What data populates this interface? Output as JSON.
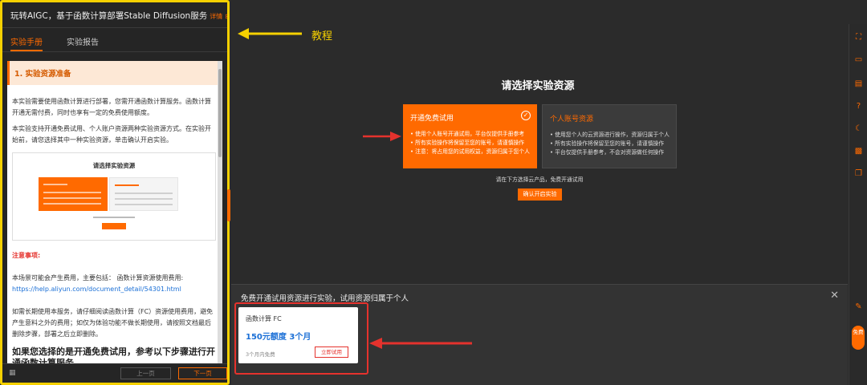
{
  "left_panel": {
    "title": "玩转AIGC，基于函数计算部署Stable Diffusion服务",
    "detail_link": "详情",
    "tabs": [
      "实验手册",
      "实验报告"
    ],
    "section_title": "1. 实验资源准备",
    "para1": "本实验需要使用函数计算进行部署，您需开通函数计算服务。函数计算开通无需付费，同时也享有一定的免费使用额度。",
    "para2": "本实验支持开通免费试用、个人账户资源两种实验资源方式。在实验开始前，请您选择其中一种实验资源，单击确认开启实验。",
    "mini_preview_title": "请选择实验资源",
    "warning_title": "注意事项:",
    "para3": "本场景可能会产生费用，主要包括： 函数计算资源使用费用:",
    "link": "https://help.aliyun.com/document_detail/54301.html",
    "para4": "如需长期使用本服务，请仔细阅读函数计算（FC）资源使用费用，避免产生意料之外的费用；如仅为体验功能不做长期使用，请按照文档最后删除步骤，部署之后立即删除。",
    "para5": "如果您选择的是开通免费试用，参考以下步骤进行开通函数计算服务。",
    "prev_button": "上一页",
    "next_button": "下一页"
  },
  "annotation": {
    "label": "教程",
    "arrow_color": "#f5d000"
  },
  "main": {
    "title": "请选择实验资源",
    "free_card": {
      "title": "开通免费试用",
      "lines": [
        "使用个人账号开通试用，平台仅提供手册参考",
        "所有实验操作将保留至您的账号，请谨慎操作",
        "注意：将占用您的试用权益，资源归属于您个人"
      ]
    },
    "own_card": {
      "title": "个人账号资源",
      "lines": [
        "使用您个人的云资源进行操作，资源归属于个人",
        "所有实验操作将保留至您的账号，请谨慎操作",
        "平台仅提供手册参考，不会对资源做任何操作"
      ]
    },
    "pick_note": "请在下方选择云产品，免费开通试用",
    "confirm_button": "确认开启实验"
  },
  "bottom_pane": {
    "heading": "免费开通试用资源进行实验，试用资源归属于个人",
    "close": "✕",
    "product": {
      "name": "函数计算 FC",
      "quota": "150元额度 3个月",
      "note": "3个月内免费",
      "button": "立即试用"
    }
  },
  "right_rail": {
    "icons": [
      "fullscreen-icon",
      "terminal-icon",
      "notebook-icon",
      "help-icon",
      "moon-icon",
      "qrcode-icon",
      "screens-icon",
      "edit-icon"
    ],
    "free_badge": "免费"
  },
  "colors": {
    "accent": "#ff6a00",
    "highlight_red": "#e5322d",
    "annotation_yellow": "#f5d000"
  }
}
